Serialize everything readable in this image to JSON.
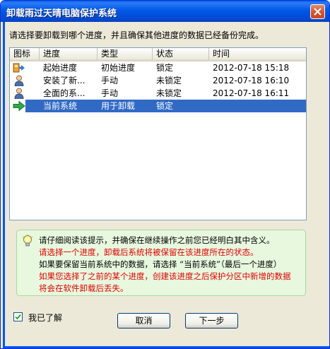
{
  "window": {
    "title": "卸载雨过天晴电脑保护系统"
  },
  "instruction": "请选择要卸载到哪个进度，并且确保其他进度的数据已经备份完成。",
  "list": {
    "columns": [
      "图标",
      "进度",
      "类型",
      "状态",
      "时间"
    ],
    "rows": [
      {
        "icon": "restore-point-icon",
        "progress": "起始进度",
        "type": "初始进度",
        "status": "锁定",
        "time": "2012-07-18 15:18",
        "selected": false
      },
      {
        "icon": "user-icon",
        "progress": "安装了新...",
        "type": "手动",
        "status": "未锁定",
        "time": "2012-07-18 16:10",
        "selected": false
      },
      {
        "icon": "user-icon",
        "progress": "全面的系...",
        "type": "手动",
        "status": "未锁定",
        "time": "2012-07-18 16:11",
        "selected": false
      },
      {
        "icon": "green-arrow-icon",
        "progress": "当前系统",
        "type": "用于卸载",
        "status": "锁定",
        "time": "",
        "selected": true
      }
    ]
  },
  "notice": {
    "lines": [
      {
        "text": "请仔细阅读该提示，并确保在继续操作之前您已经明白其中含义。",
        "color": "#000000"
      },
      {
        "text": "请选择一个进度，卸载后系统将被保留在该进度所在的状态。",
        "color": "#E00000"
      },
      {
        "text": "如果要保留当前系统中的数据，请选择 “当前系统”（最后一个进度）",
        "color": "#000000"
      },
      {
        "text": "如果您选择了之前的某个进度，创建该进度之后保护分区中新增的数据",
        "color": "#E00000"
      },
      {
        "text": "将会在软件卸载后丢失。",
        "color": "#E00000"
      }
    ]
  },
  "confirm": {
    "label": "我已了解",
    "checked": true
  },
  "buttons": {
    "cancel": "取消",
    "next": "下一步"
  },
  "colors": {
    "titlebar": "#0058E6",
    "selection": "#316AC5",
    "notice_bg": "#E7F8DF",
    "warning_text": "#E00000"
  }
}
